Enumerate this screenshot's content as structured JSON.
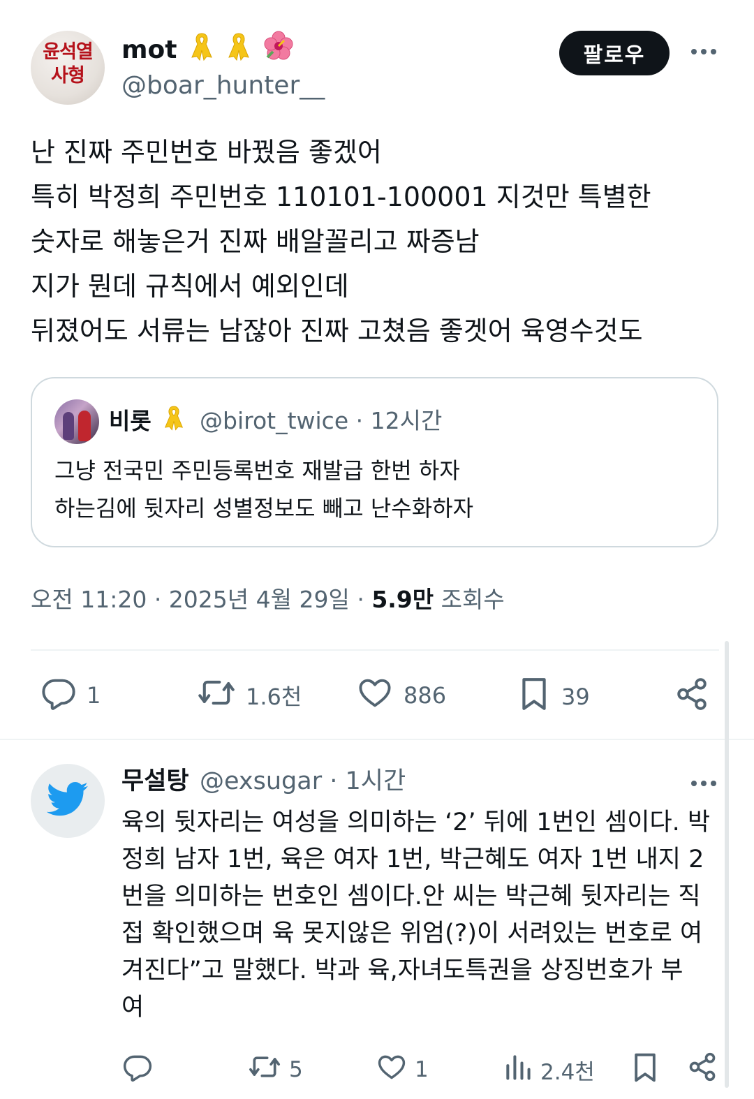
{
  "author": {
    "name": "mot",
    "handle": "@boar_hunter__",
    "avatar_text_line1": "윤석열",
    "avatar_text_line2": "사형",
    "badges": [
      "yellow-ribbon-icon",
      "yellow-ribbon-icon",
      "hibiscus-flower-icon"
    ]
  },
  "follow_label": "팔로우",
  "tweet": {
    "lines": [
      "난 진짜 주민번호 바꿨음 좋겠어",
      "특히 박정희 주민번호 110101-100001 지것만 특별한",
      "숫자로 해놓은거 진짜 배알꼴리고 짜증남",
      "지가 뭔데 규칙에서 예외인데",
      "뒤졌어도 서류는 남잖아 진짜 고쳤음 좋겟어 육영수것도"
    ]
  },
  "quote": {
    "name": "비롯",
    "handle": "@birot_twice",
    "time": "12시간",
    "lines": [
      "그냥 전국민 주민등록번호 재발급 한번 하자",
      "하는김에 뒷자리 성별정보도 빼고 난수화하자"
    ]
  },
  "meta": {
    "time": "오전 11:20",
    "date": "2025년 4월 29일",
    "views": "5.9만",
    "views_label": "조회수"
  },
  "stats": {
    "replies": "1",
    "retweets": "1.6천",
    "likes": "886",
    "bookmarks": "39"
  },
  "reply": {
    "name": "무설탕",
    "handle": "@exsugar",
    "time": "1시간",
    "lines": [
      "육의 뒷자리는 여성을 의미하는 ‘2’ 뒤에 1번인 셈이다. 박",
      "정희 남자 1번, 육은 여자 1번, 박근혜도 여자 1번 내지 2",
      "번을 의미하는 번호인 셈이다.안 씨는 박근혜 뒷자리는 직",
      "접 확인했으며 육 못지않은 위엄(?)이 서려있는 번호로 여",
      "겨진다”고 말했다.   박과 육,자녀도특권을 상징번호가 부",
      "여"
    ],
    "stats": {
      "retweets": "5",
      "likes": "1",
      "views": "2.4천"
    }
  },
  "colors": {
    "text": "#0f1419",
    "secondary": "#536471",
    "border": "#cfd9de",
    "ribbon": "#f5c518",
    "twitter_blue": "#1d9bf0"
  }
}
